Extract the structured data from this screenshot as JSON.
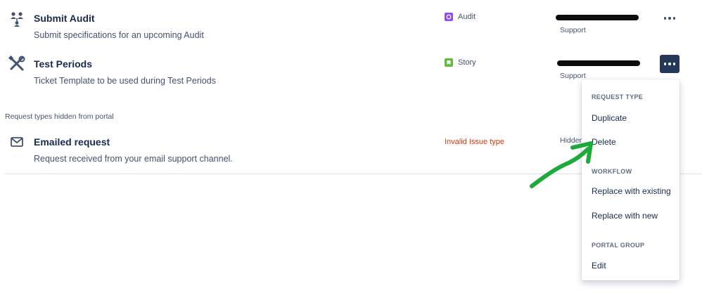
{
  "request_types": [
    {
      "title": "Submit Audit",
      "description": "Submit specifications for an upcoming Audit",
      "icon": "people-network-icon",
      "issue_type": "Audit",
      "issue_type_color": "#904ee2",
      "group": "Support"
    },
    {
      "title": "Test Periods",
      "description": "Ticket Template to be used during Test Periods",
      "icon": "tools-icon",
      "issue_type": "Story",
      "issue_type_color": "#63ba3c",
      "group": "Support"
    }
  ],
  "hidden_section_label": "Request types hidden from portal",
  "hidden_request": {
    "title": "Emailed request",
    "description": "Request received from your email support channel.",
    "icon": "envelope-icon",
    "issue_type_error": "Invalid Issue type",
    "issue_type_error_color": "#de350b",
    "group": "Hidden"
  },
  "menu": {
    "request_type_heading": "REQUEST TYPE",
    "duplicate": "Duplicate",
    "delete": "Delete",
    "workflow_heading": "WORKFLOW",
    "replace_existing": "Replace with existing",
    "replace_new": "Replace with new",
    "portal_group_heading": "PORTAL GROUP",
    "edit": "Edit"
  },
  "colors": {
    "active_button": "#253858",
    "annotation_arrow": "#1eaa3a"
  }
}
